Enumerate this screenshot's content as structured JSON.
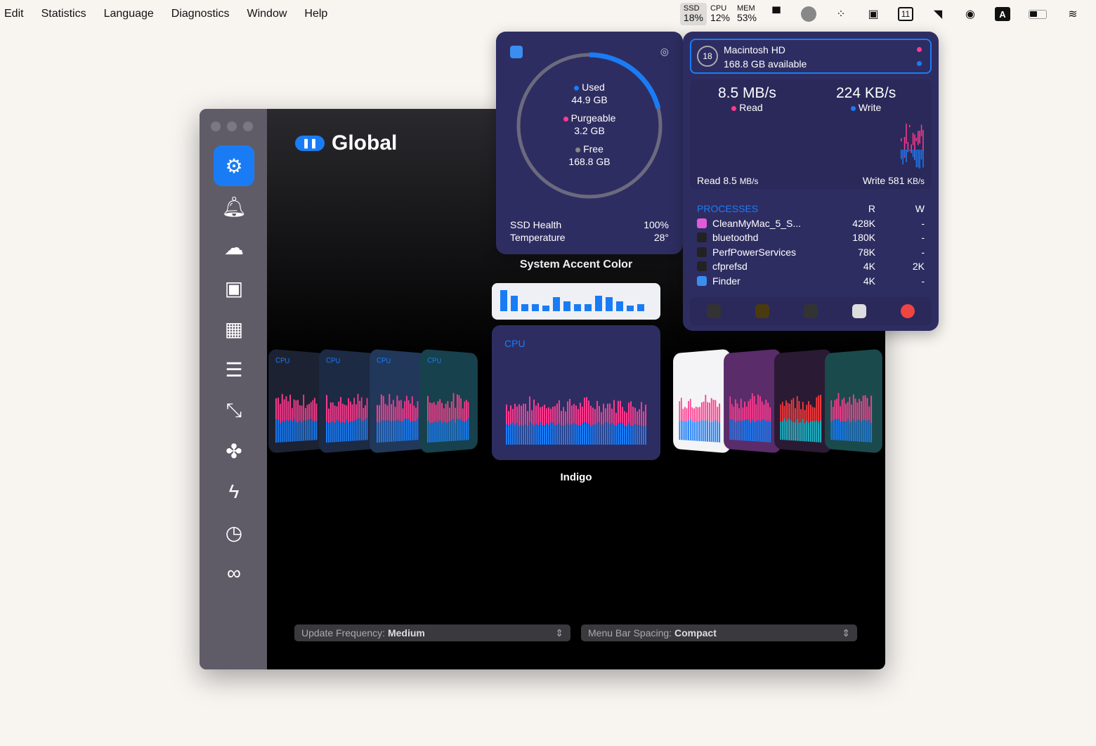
{
  "menu": [
    "Edit",
    "Statistics",
    "Language",
    "Diagnostics",
    "Window",
    "Help"
  ],
  "tray": {
    "ssd": {
      "label": "SSD",
      "value": "18%"
    },
    "cpu": {
      "label": "CPU",
      "value": "12%"
    },
    "mem": {
      "label": "MEM",
      "value": "53%"
    },
    "calendar_day": "11",
    "input_source": "A"
  },
  "sidebar": [
    "settings",
    "notifications",
    "weather",
    "cpu",
    "memory",
    "disk",
    "network",
    "fans",
    "battery",
    "clock",
    "bluetooth"
  ],
  "main": {
    "title": "Global",
    "accent_label": "System Accent Color",
    "selected_theme": "Indigo",
    "card_label": "CPU",
    "update_frequency": {
      "label": "Update Frequency:",
      "value": "Medium"
    },
    "menu_spacing": {
      "label": "Menu Bar Spacing:",
      "value": "Compact"
    }
  },
  "disk_popover": {
    "used": {
      "label": "Used",
      "value": "44.9 GB"
    },
    "purgeable": {
      "label": "Purgeable",
      "value": "3.2 GB"
    },
    "free": {
      "label": "Free",
      "value": "168.8 GB"
    },
    "health_label": "SSD Health",
    "health": "100%",
    "temp_label": "Temperature",
    "temp": "28°",
    "used_fraction": 0.21
  },
  "io_popover": {
    "drive_badge": "18",
    "drive_name": "Macintosh HD",
    "available": "168.8 GB available",
    "read_rate": "8.5 MB/s",
    "read_label": "Read",
    "write_rate": "224 KB/s",
    "write_label": "Write",
    "read_footer_label": "Read",
    "read_footer": "8.5",
    "read_unit": "MB/s",
    "write_footer_label": "Write",
    "write_footer": "581",
    "write_unit": "KB/s",
    "processes_header": "PROCESSES",
    "col_r": "R",
    "col_w": "W",
    "processes": [
      {
        "name": "CleanMyMac_5_S...",
        "r": "428K",
        "w": "-"
      },
      {
        "name": "bluetoothd",
        "r": "180K",
        "w": "-"
      },
      {
        "name": "PerfPowerServices",
        "r": "78K",
        "w": "-"
      },
      {
        "name": "cfprefsd",
        "r": "4K",
        "w": "2K"
      },
      {
        "name": "Finder",
        "r": "4K",
        "w": "-"
      }
    ]
  },
  "colors": {
    "accent": "#1a7cf5",
    "indigo": "#2e2d62",
    "read": "#ff3b8e",
    "write": "#1a7cf5"
  }
}
